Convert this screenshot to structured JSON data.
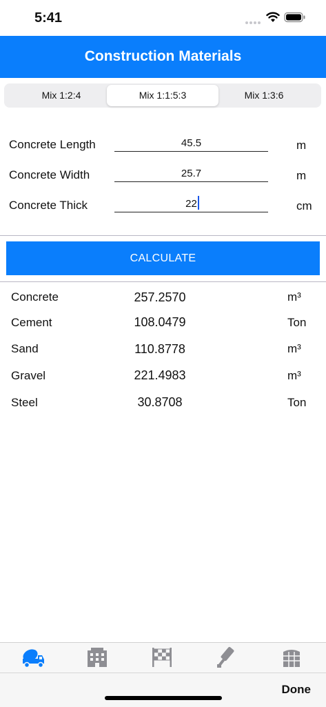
{
  "status_bar": {
    "time": "5:41"
  },
  "nav": {
    "title": "Construction Materials"
  },
  "mix_segments": [
    {
      "label": "Mix 1:2:4",
      "selected": false
    },
    {
      "label": "Mix 1:1:5:3",
      "selected": true
    },
    {
      "label": "Mix 1:3:6",
      "selected": false
    }
  ],
  "inputs": [
    {
      "label": "Concrete Length",
      "value": "45.5",
      "unit": "m"
    },
    {
      "label": "Concrete Width",
      "value": "25.7",
      "unit": "m"
    },
    {
      "label": "Concrete Thick",
      "value": "22",
      "unit": "cm"
    }
  ],
  "calculate_label": "CALCULATE",
  "results": [
    {
      "name": "Concrete",
      "value": "257.2570",
      "unit": "m³"
    },
    {
      "name": "Cement",
      "value": "108.0479",
      "unit": "Ton"
    },
    {
      "name": "Sand",
      "value": "110.8778",
      "unit": "m³"
    },
    {
      "name": "Gravel",
      "value": "221.4983",
      "unit": "m³"
    },
    {
      "name": "Steel",
      "value": "30.8708",
      "unit": "Ton"
    }
  ],
  "tabs": [
    {
      "icon": "concrete-mixer-truck-icon",
      "active": true
    },
    {
      "icon": "building-icon",
      "active": false
    },
    {
      "icon": "checkered-flag-icon",
      "active": false
    },
    {
      "icon": "paint-roller-icon",
      "active": false
    },
    {
      "icon": "tiles-icon",
      "active": false
    }
  ],
  "keyboard_toolbar": {
    "done_label": "Done"
  },
  "colors": {
    "accent": "#0a7efc",
    "inactive_tab": "#8e8e93"
  }
}
